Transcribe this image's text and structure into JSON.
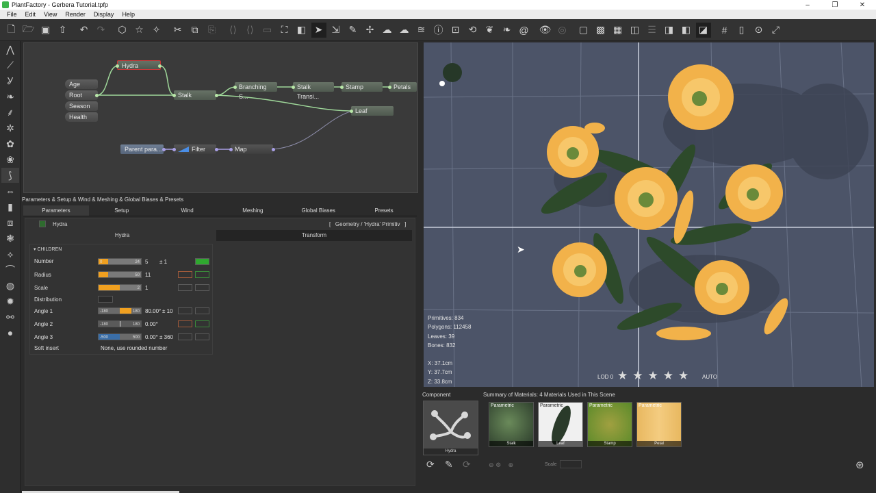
{
  "window": {
    "title": "PlantFactory - Gerbera Tutorial.tpfp"
  },
  "menu": [
    "File",
    "Edit",
    "View",
    "Render",
    "Display",
    "Help"
  ],
  "graph": {
    "inputs": [
      "Age",
      "Root",
      "Season",
      "Health"
    ],
    "nodes": {
      "hydra": "Hydra",
      "stalk": "Stalk",
      "branching": "Branching S...",
      "stalk_transition": "Stalk Transi...",
      "stamp": "Stamp",
      "petals": "Petals",
      "leaf": "Leaf",
      "parent": "Parent para...",
      "filter": "Filter",
      "map": "Map"
    }
  },
  "params": {
    "header": "Parameters & Setup & Wind & Meshing & Global Biases & Presets",
    "tabs": [
      "Parameters",
      "Setup",
      "Wind",
      "Meshing",
      "Global Biases",
      "Presets"
    ],
    "node_name": "Hydra",
    "geometry_path": "Geometry / 'Hydra' Primitiv",
    "subtabs": [
      "Hydra",
      "Transform"
    ],
    "section": "CHILDREN",
    "rows": {
      "number": {
        "label": "Number",
        "lo": "0",
        "hi": "24",
        "value": "5",
        "extra": "± 1"
      },
      "radius": {
        "label": "Radius",
        "hi": "50",
        "value": "11"
      },
      "scale": {
        "label": "Scale",
        "hi": "2",
        "value": "1"
      },
      "distribution": {
        "label": "Distribution"
      },
      "angle1": {
        "label": "Angle 1",
        "lo": "-180",
        "hi": "180",
        "value": "80.00°",
        "extra": "± 10"
      },
      "angle2": {
        "label": "Angle 2",
        "lo": "-180",
        "hi": "180",
        "value": "0.00°"
      },
      "angle3": {
        "label": "Angle 3",
        "lo": "-500",
        "hi": "500",
        "value": "0.00°",
        "extra": "± 360"
      },
      "soft_insert": {
        "label": "Soft insert",
        "value": "None, use rounded number"
      }
    }
  },
  "viewport": {
    "stats": [
      "Primitives: 834",
      "Polygons: 112458",
      "Leaves: 39",
      "Bones: 832"
    ],
    "coords": [
      "X: 37.1cm",
      "Y: 37.7cm",
      "Z: 33.8cm"
    ],
    "lod_label": "LOD 0",
    "lod_auto": "AUTO",
    "lod_stars": 5
  },
  "component": {
    "title": "Component",
    "name": "Hydra"
  },
  "materials": {
    "title": "Summary of Materials: 4 Materials Used in This Scene",
    "items": [
      {
        "tag": "Parametric",
        "name": "Stalk"
      },
      {
        "tag": "Parametric",
        "name": "Leaf"
      },
      {
        "tag": "Parametric",
        "name": "Stamp"
      },
      {
        "tag": "Parametric",
        "name": "Petal"
      }
    ],
    "scale_label": "Scale"
  },
  "colors": {
    "accent": "#f0a020",
    "green": "#2fa82f",
    "viewport_bg": "#4c5468"
  }
}
